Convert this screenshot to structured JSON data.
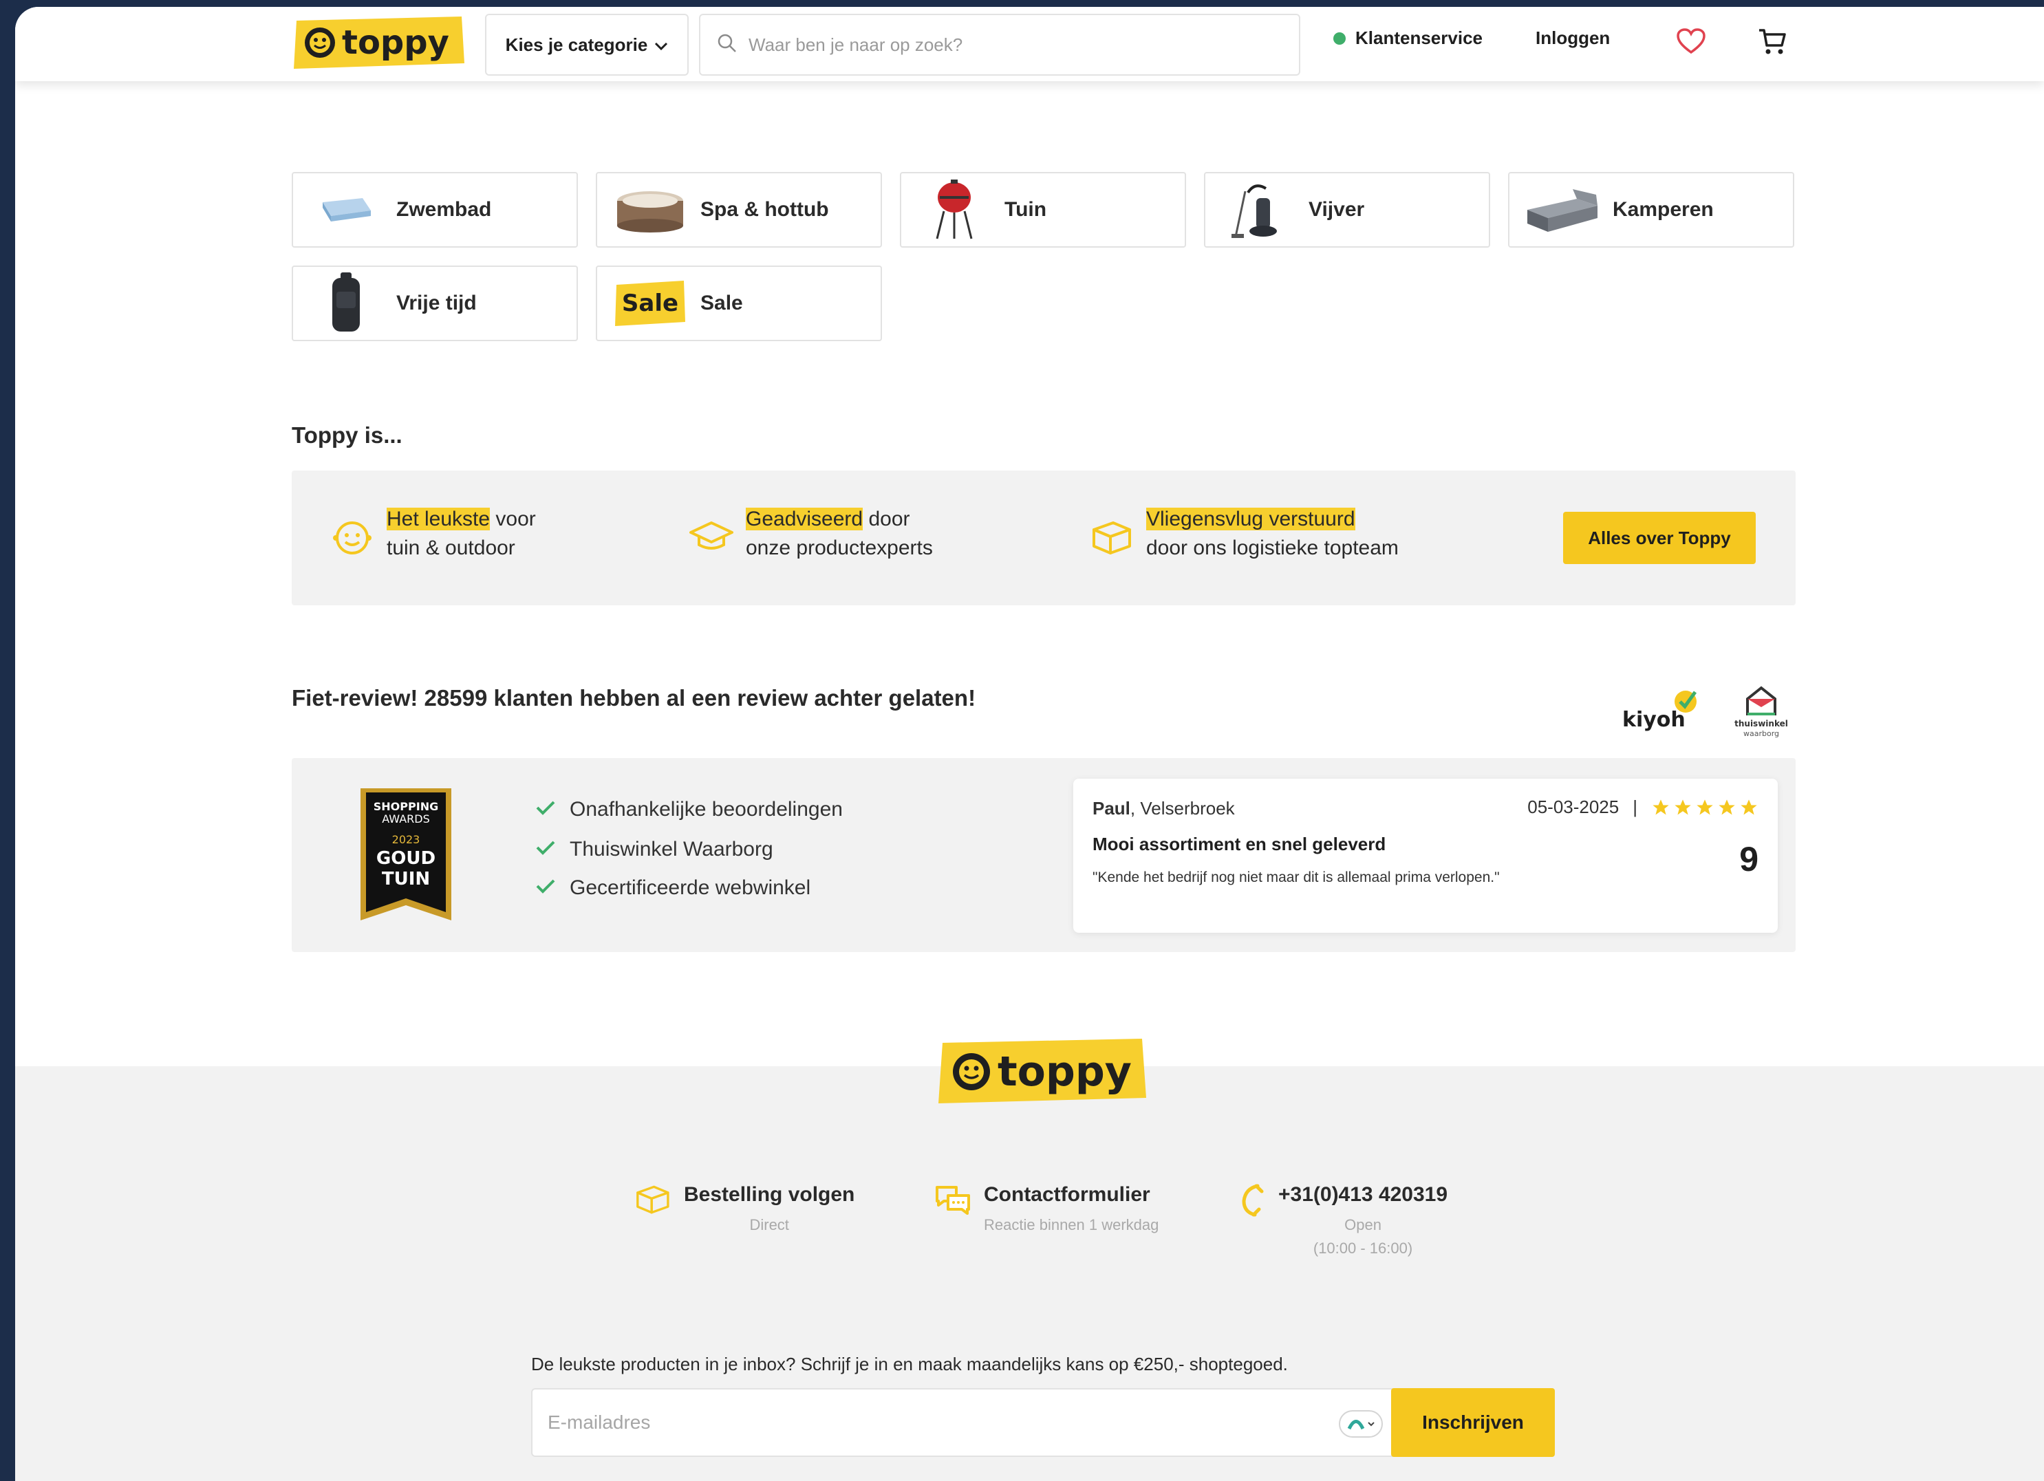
{
  "header": {
    "logo_text": "toppy",
    "category_label": "Kies je categorie",
    "search_placeholder": "Waar ben je naar op zoek?",
    "customer_service": "Klantenservice",
    "login": "Inloggen"
  },
  "categories": [
    {
      "label": "Zwembad",
      "icon": "pool-icon"
    },
    {
      "label": "Spa & hottub",
      "icon": "hottub-icon"
    },
    {
      "label": "Tuin",
      "icon": "bbq-icon"
    },
    {
      "label": "Vijver",
      "icon": "pond-vacuum-icon"
    },
    {
      "label": "Kamperen",
      "icon": "air-mattress-icon"
    },
    {
      "label": "Vrije tijd",
      "icon": "backpack-icon"
    },
    {
      "label": "Sale",
      "icon": "sale-badge-icon",
      "badge_text": "Sale"
    }
  ],
  "toppy_is": {
    "heading": "Toppy is...",
    "usps": [
      {
        "highlight": "Het leukste",
        "rest": " voor",
        "line2": "tuin & outdoor"
      },
      {
        "highlight": "Geadviseerd",
        "rest": " door",
        "line2": "onze productexperts"
      },
      {
        "highlight": "Vliegensvlug verstuurd",
        "rest": "",
        "line2": "door ons logistieke topteam"
      }
    ],
    "button": "Alles over Toppy"
  },
  "reviews": {
    "heading": "Fiet-review! 28599 klanten hebben al een review achter gelaten!",
    "kiyoh": "kiyoh",
    "thuiswinkel_line1": "thuiswinkel",
    "thuiswinkel_line2": "waarborg",
    "award": {
      "line1": "SHOPPING",
      "line2": "AWARDS",
      "year": "2023",
      "line3": "GOUD",
      "line4": "TUIN"
    },
    "checks": [
      "Onafhankelijke beoordelingen",
      "Thuiswinkel Waarborg",
      "Gecertificeerde webwinkel"
    ],
    "card": {
      "name": "Paul",
      "city": ", Velserbroek",
      "date": "05-03-2025",
      "separator": "|",
      "stars": 5,
      "title": "Mooi assortiment en snel geleverd",
      "text": "\"Kende het bedrijf nog niet maar dit is allemaal prima verlopen.\"",
      "score": "9"
    }
  },
  "footer": {
    "logo_text": "toppy",
    "contacts": [
      {
        "title": "Bestelling volgen",
        "sub": "Direct"
      },
      {
        "title": "Contactformulier",
        "sub": "Reactie binnen 1 werkdag"
      },
      {
        "title": "+31(0)413 420319",
        "sub": "Open",
        "sub2": "(10:00 - 16:00)"
      }
    ],
    "newsletter_text": "De leukste producten in je inbox? Schrijf je in en maak maandelijks kans op €250,- shoptegoed.",
    "email_placeholder": "E-mailadres",
    "subscribe": "Inschrijven"
  },
  "colors": {
    "brand_yellow": "#f5c71f",
    "status_green": "#3fae6a",
    "heart": "#e0424f"
  }
}
